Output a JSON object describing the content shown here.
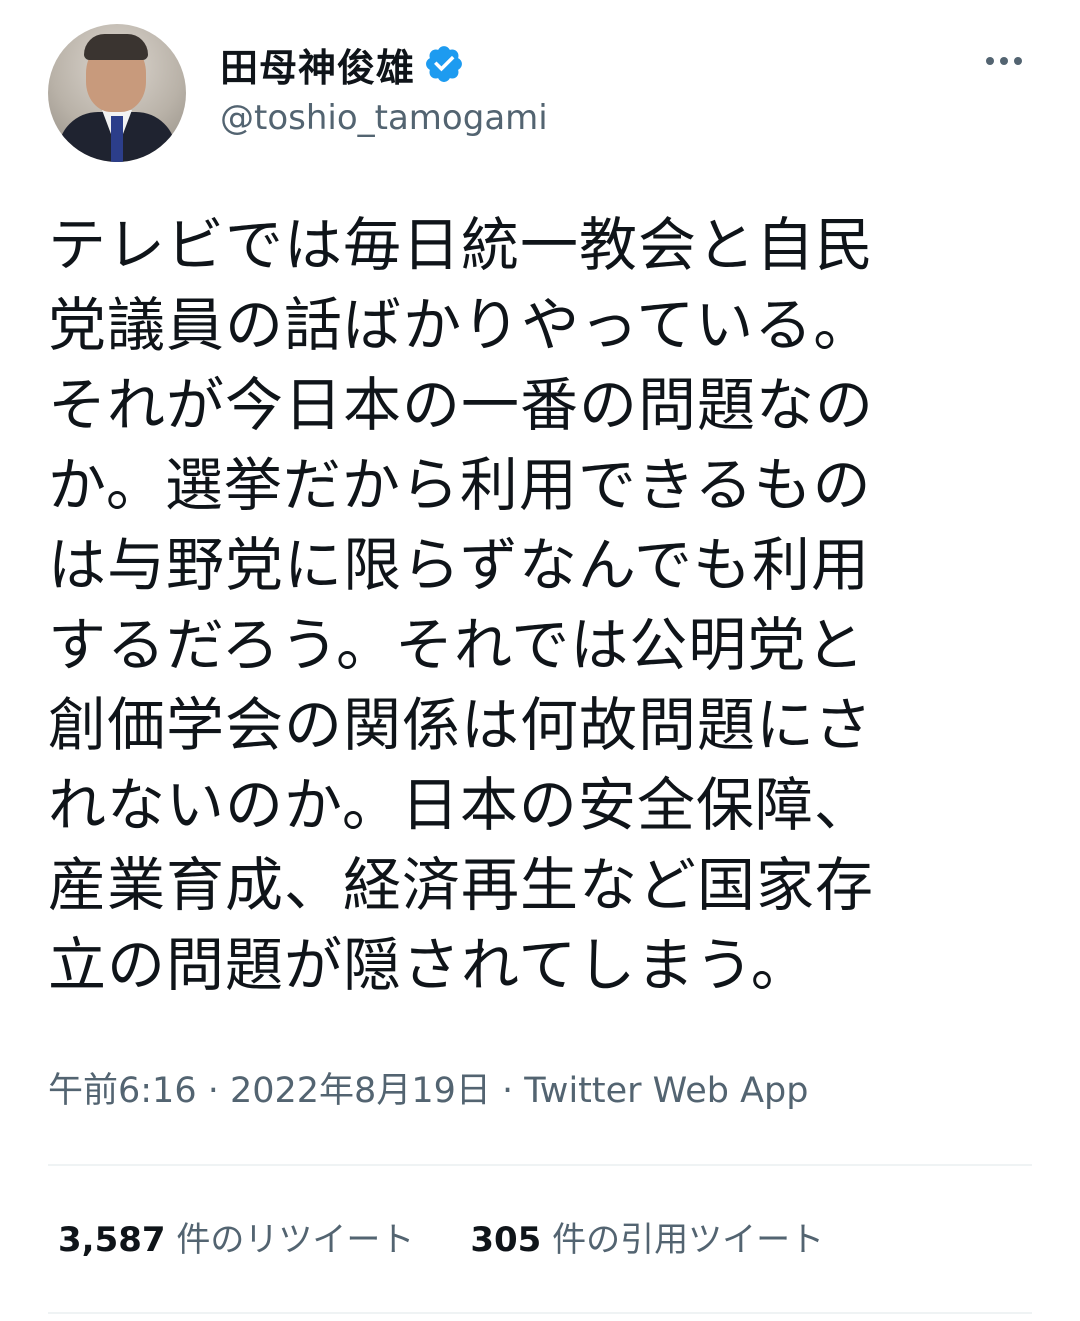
{
  "user": {
    "display_name": "田母神俊雄",
    "handle": "@toshio_tamogami",
    "verified_icon": "verified-badge-icon",
    "verified_color": "#1d9bf0"
  },
  "tweet": {
    "lines": [
      "テレビでは毎日統一教会と自民",
      "党議員の話ばかりやっている。",
      "それが今日本の一番の問題なの",
      "か。選挙だから利用できるもの",
      "は与野党に限らずなんでも利用",
      "するだろう。それでは公明党と",
      "創価学会の関係は何故問題にさ",
      "れないのか。日本の安全保障、",
      "産業育成、経済再生など国家存",
      "立の問題が隠されてしまう。"
    ],
    "meta": "午前6:16 · 2022年8月19日 · Twitter Web App"
  },
  "stats": {
    "retweets_count": "3,587",
    "retweets_label": "件のリツイート",
    "quotes_count": "305",
    "quotes_label": "件の引用ツイート"
  },
  "icons": {
    "more": "more-horizontal-icon"
  }
}
